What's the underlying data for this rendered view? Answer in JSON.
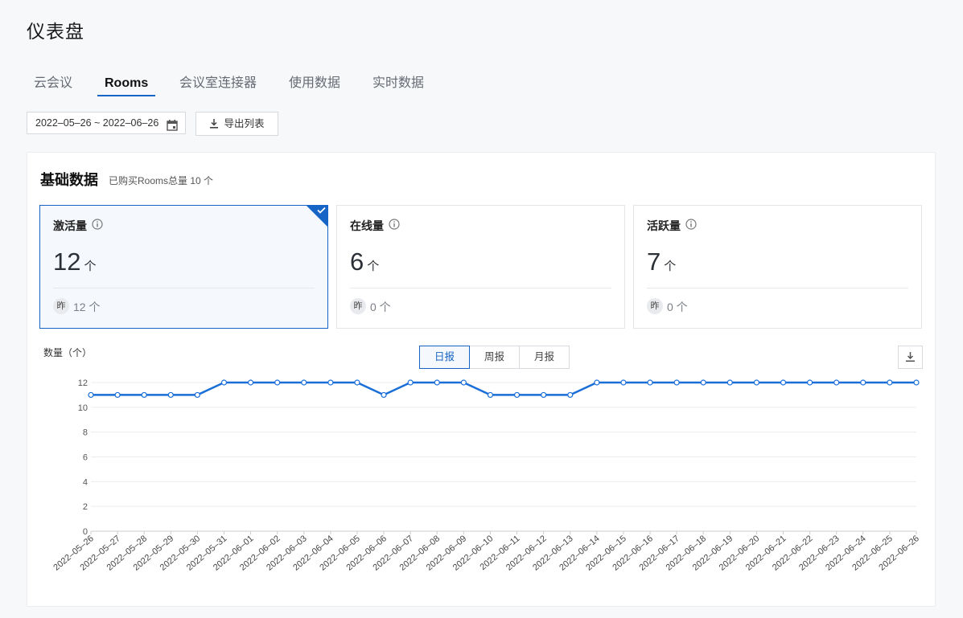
{
  "page": {
    "title": "仪表盘"
  },
  "tabs": [
    {
      "label": "云会议",
      "active": false
    },
    {
      "label": "Rooms",
      "active": true
    },
    {
      "label": "会议室连接器",
      "active": false
    },
    {
      "label": "使用数据",
      "active": false
    },
    {
      "label": "实时数据",
      "active": false
    }
  ],
  "toolbar": {
    "date_range": "2022–05–26 ~ 2022–06–26",
    "export_label": "导出列表"
  },
  "basic": {
    "title": "基础数据",
    "subtitle": "已购买Rooms总量 10 个",
    "stats": [
      {
        "label": "激活量",
        "value": "12",
        "unit": "个",
        "yesterday_badge": "昨",
        "yesterday": "12 个",
        "selected": true
      },
      {
        "label": "在线量",
        "value": "6",
        "unit": "个",
        "yesterday_badge": "昨",
        "yesterday": "0 个",
        "selected": false
      },
      {
        "label": "活跃量",
        "value": "7",
        "unit": "个",
        "yesterday_badge": "昨",
        "yesterday": "0 个",
        "selected": false
      }
    ]
  },
  "chart_controls": {
    "y_title": "数量（个）",
    "segments": [
      {
        "label": "日报",
        "active": true
      },
      {
        "label": "周报",
        "active": false
      },
      {
        "label": "月报",
        "active": false
      }
    ]
  },
  "colors": {
    "accent": "#1664c6",
    "line": "#1a6ed8"
  },
  "icons": {
    "calendar": "calendar-icon",
    "download": "download-icon",
    "info": "info-icon",
    "check": "check-icon"
  },
  "chart_data": {
    "type": "line",
    "ylabel": "数量（个）",
    "ylim": [
      0,
      12
    ],
    "yticks": [
      0,
      2,
      4,
      6,
      8,
      10,
      12
    ],
    "grid": true,
    "categories": [
      "2022–05–26",
      "2022–05–27",
      "2022–05–28",
      "2022–05–29",
      "2022–05–30",
      "2022–05–31",
      "2022–06–01",
      "2022–06–02",
      "2022–06–03",
      "2022–06–04",
      "2022–06–05",
      "2022–06–06",
      "2022–06–07",
      "2022–06–08",
      "2022–06–09",
      "2022–06–10",
      "2022–06–11",
      "2022–06–12",
      "2022–06–13",
      "2022–06–14",
      "2022–06–15",
      "2022–06–16",
      "2022–06–17",
      "2022–06–18",
      "2022–06–19",
      "2022–06–20",
      "2022–06–21",
      "2022–06–22",
      "2022–06–23",
      "2022–06–24",
      "2022–06–25",
      "2022–06–26"
    ],
    "series": [
      {
        "values": [
          11,
          11,
          11,
          11,
          11,
          12,
          12,
          12,
          12,
          12,
          12,
          11,
          12,
          12,
          12,
          11,
          11,
          11,
          11,
          12,
          12,
          12,
          12,
          12,
          12,
          12,
          12,
          12,
          12,
          12,
          12,
          12
        ]
      }
    ]
  }
}
